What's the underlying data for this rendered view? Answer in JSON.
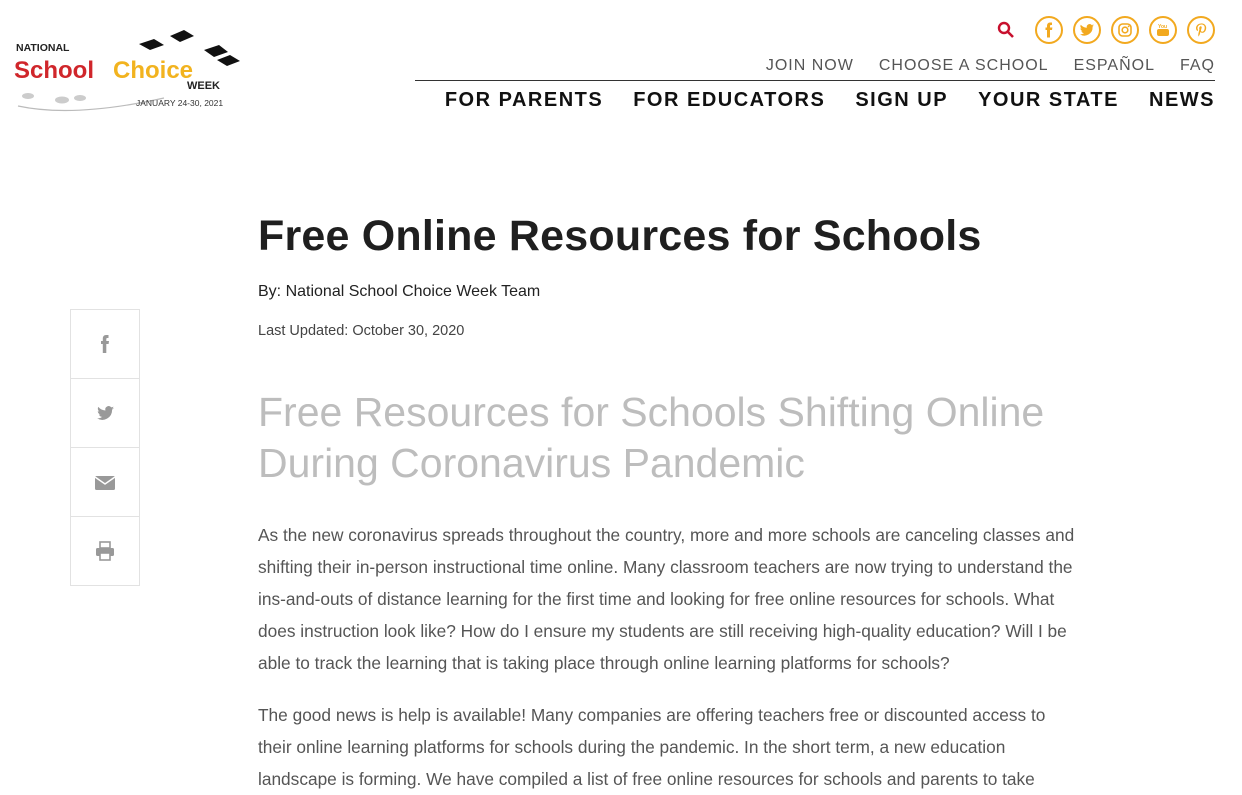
{
  "logo": {
    "line1": "NATIONAL",
    "school": "School",
    "choice": "Choice",
    "week": "WEEK",
    "dates": "JANUARY 24-30, 2021"
  },
  "colors": {
    "accent": "#f2a91f",
    "logo_red": "#d0262b",
    "search": "#c8102e"
  },
  "social": {
    "search_icon": "search-icon",
    "icons": [
      "facebook-icon",
      "twitter-icon",
      "instagram-icon",
      "youtube-icon",
      "pinterest-icon"
    ]
  },
  "util_nav": [
    "JOIN NOW",
    "CHOOSE A SCHOOL",
    "ESPAÑOL",
    "FAQ"
  ],
  "main_nav": [
    "FOR PARENTS",
    "FOR EDUCATORS",
    "SIGN UP",
    "YOUR STATE",
    "NEWS"
  ],
  "share": [
    "facebook-icon",
    "twitter-icon",
    "email-icon",
    "print-icon"
  ],
  "article": {
    "title": "Free Online Resources for Schools",
    "byline": "By: National School Choice Week Team",
    "updated": "Last Updated: October 30, 2020",
    "subtitle": "Free Resources for Schools Shifting Online During Coronavirus Pandemic",
    "paragraphs": [
      "As the new coronavirus spreads throughout the country, more and more schools are canceling classes and shifting their in-person instructional time online. Many classroom teachers are now trying to understand the ins-and-outs of distance learning for the first time and looking for free online resources for schools. What does instruction look like? How do I ensure my students are still receiving high-quality education? Will I be able to track the learning that is taking place through online learning platforms for schools?",
      "The good news is help is available! Many companies are offering teachers free or discounted access to their online learning platforms for schools during the pandemic. In the short term, a new education landscape is forming. We have compiled a list of free online resources for schools and parents to take"
    ]
  }
}
